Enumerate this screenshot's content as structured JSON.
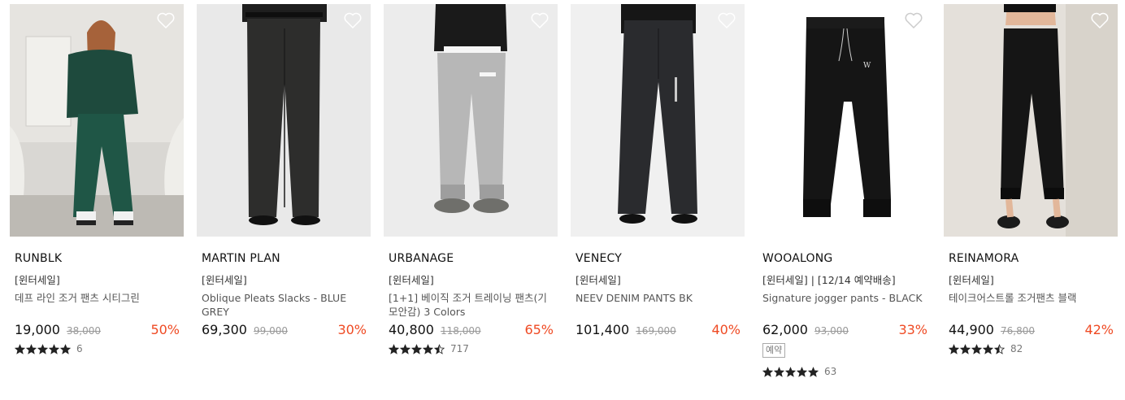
{
  "products": [
    {
      "brand": "RUNBLK",
      "tag": "[윈터세일]",
      "name": "데프 라인 조거 팬츠 시티그린",
      "price": "19,000",
      "original_price": "38,000",
      "discount": "50%",
      "badge": "",
      "review_count": "6",
      "rating_stars": 5
    },
    {
      "brand": "MARTIN PLAN",
      "tag": "[윈터세일]",
      "name": "Oblique Pleats Slacks - BLUE GREY",
      "price": "69,300",
      "original_price": "99,000",
      "discount": "30%",
      "badge": "",
      "review_count": "",
      "rating_stars": 0
    },
    {
      "brand": "URBANAGE",
      "tag": "[윈터세일]",
      "name": "[1+1] 베이직 조거 트레이닝 팬츠(기모안감) 3 Colors",
      "price": "40,800",
      "original_price": "118,000",
      "discount": "65%",
      "badge": "",
      "review_count": "717",
      "rating_stars": 4.5
    },
    {
      "brand": "VENECY",
      "tag": "[윈터세일]",
      "name": "NEEV DENIM PANTS BK",
      "price": "101,400",
      "original_price": "169,000",
      "discount": "40%",
      "badge": "",
      "review_count": "",
      "rating_stars": 0
    },
    {
      "brand": "WOOALONG",
      "tag": "[윈터세일] | [12/14 예약배송]",
      "name": "Signature jogger pants - BLACK",
      "price": "62,000",
      "original_price": "93,000",
      "discount": "33%",
      "badge": "예약",
      "review_count": "63",
      "rating_stars": 5
    },
    {
      "brand": "REINAMORA",
      "tag": "[윈터세일]",
      "name": "테이크어스트롤 조거팬츠 블랙",
      "price": "44,900",
      "original_price": "76,800",
      "discount": "42%",
      "badge": "",
      "review_count": "82",
      "rating_stars": 4.5
    }
  ],
  "colors": {
    "discount": "#ef4a23",
    "star": "#222222",
    "heart": "#ffffff"
  },
  "icons": {
    "wishlist": "heart-outline-icon",
    "rating": "star-icon"
  }
}
